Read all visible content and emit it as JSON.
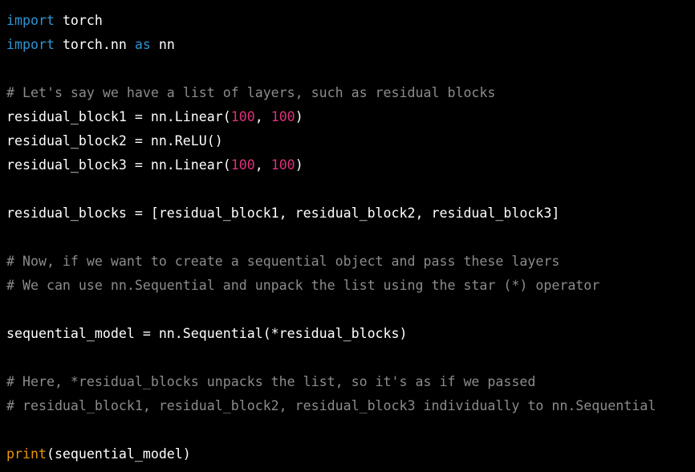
{
  "language": "python",
  "colors": {
    "background": "#000000",
    "keyword": "#2e95d3",
    "comment": "#8b8b8b",
    "number": "#df3079",
    "builtin": "#e9950c",
    "plain": "#ffffff"
  },
  "code": {
    "lines": [
      [
        {
          "t": "import",
          "k": "keyword"
        },
        {
          "t": " torch",
          "k": "plain"
        }
      ],
      [
        {
          "t": "import",
          "k": "keyword"
        },
        {
          "t": " torch.nn ",
          "k": "plain"
        },
        {
          "t": "as",
          "k": "keyword"
        },
        {
          "t": " nn",
          "k": "plain"
        }
      ],
      [],
      [
        {
          "t": "# Let's say we have a list of layers, such as residual blocks",
          "k": "comment"
        }
      ],
      [
        {
          "t": "residual_block1 = nn.Linear(",
          "k": "plain"
        },
        {
          "t": "100",
          "k": "number"
        },
        {
          "t": ", ",
          "k": "plain"
        },
        {
          "t": "100",
          "k": "number"
        },
        {
          "t": ")",
          "k": "plain"
        }
      ],
      [
        {
          "t": "residual_block2 = nn.ReLU()",
          "k": "plain"
        }
      ],
      [
        {
          "t": "residual_block3 = nn.Linear(",
          "k": "plain"
        },
        {
          "t": "100",
          "k": "number"
        },
        {
          "t": ", ",
          "k": "plain"
        },
        {
          "t": "100",
          "k": "number"
        },
        {
          "t": ")",
          "k": "plain"
        }
      ],
      [],
      [
        {
          "t": "residual_blocks = [residual_block1, residual_block2, residual_block3]",
          "k": "plain"
        }
      ],
      [],
      [
        {
          "t": "# Now, if we want to create a sequential object and pass these layers",
          "k": "comment"
        }
      ],
      [
        {
          "t": "# We can use nn.Sequential and unpack the list using the star (*) operator",
          "k": "comment"
        }
      ],
      [],
      [
        {
          "t": "sequential_model = nn.Sequential(*residual_blocks)",
          "k": "plain"
        }
      ],
      [],
      [
        {
          "t": "# Here, *residual_blocks unpacks the list, so it's as if we passed",
          "k": "comment"
        }
      ],
      [
        {
          "t": "# residual_block1, residual_block2, residual_block3 individually to nn.Sequential",
          "k": "comment"
        }
      ],
      [],
      [
        {
          "t": "print",
          "k": "builtin"
        },
        {
          "t": "(sequential_model)",
          "k": "plain"
        }
      ]
    ]
  }
}
